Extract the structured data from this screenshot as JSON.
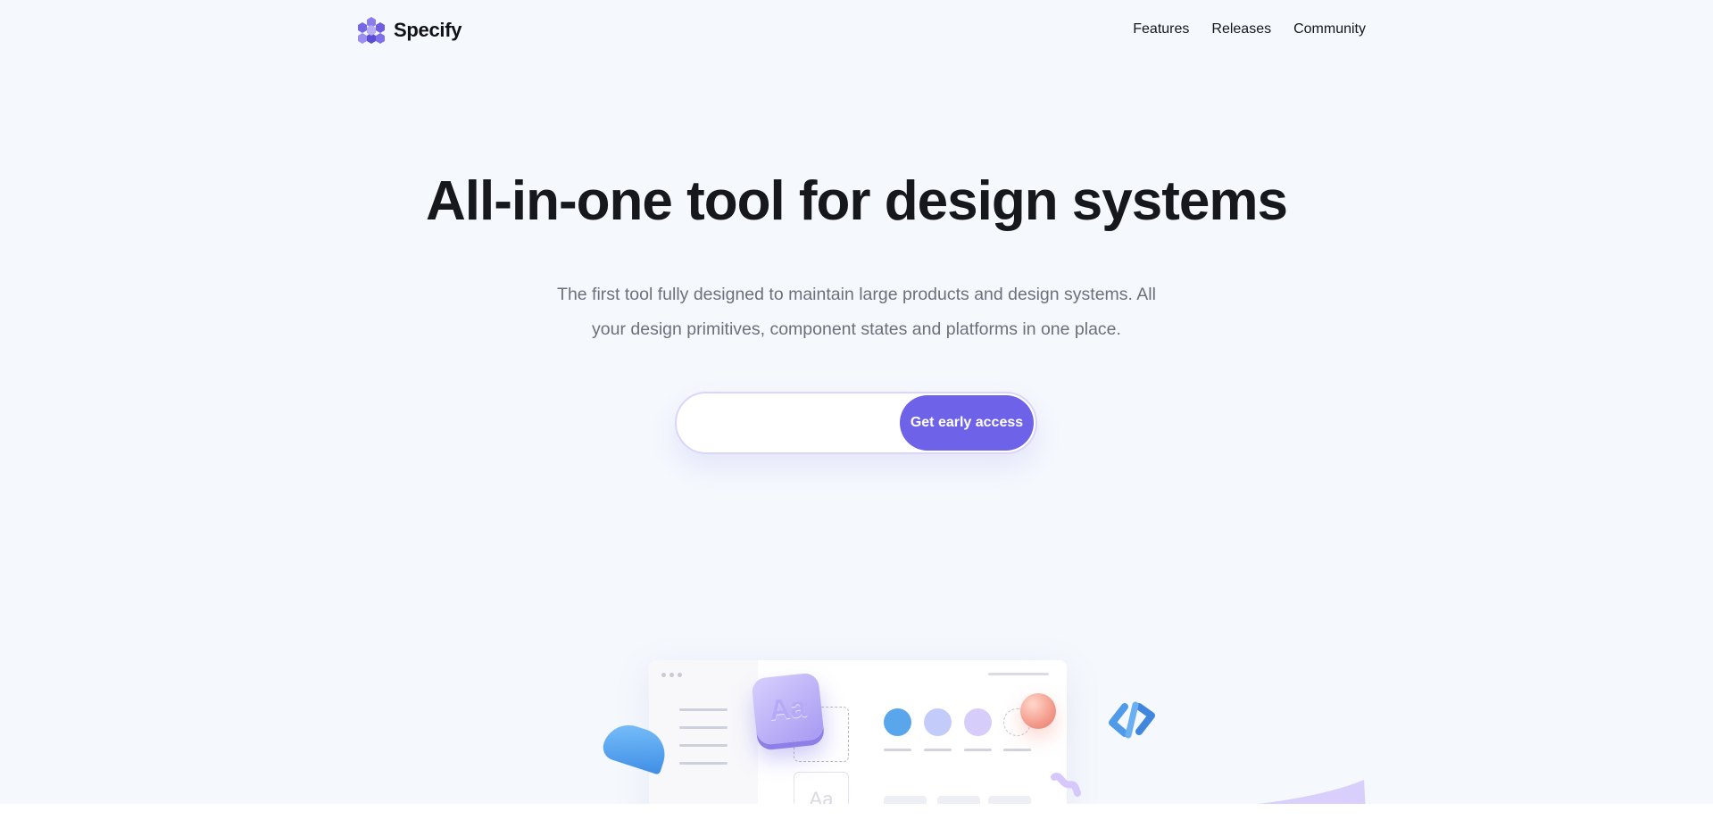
{
  "brand": {
    "name": "Specify",
    "logo_icon": "hexagon-cube-logo-icon",
    "accent_color": "#6e62e8"
  },
  "nav": {
    "items": [
      "Features",
      "Releases",
      "Community"
    ]
  },
  "hero": {
    "headline": "All-in-one tool for design systems",
    "subtitle": "The first tool fully designed to maintain large products and design systems. All your design primitives, component states and platforms in one place."
  },
  "signup": {
    "email_value": "",
    "email_placeholder": "",
    "cta_label": "Get early access"
  },
  "illustration": {
    "typography_tile_text": "Aa",
    "typography_ghost_text": "Aa",
    "swatch_colors": [
      "#5aa6ec",
      "#c3cbfb",
      "#d7cdfb"
    ],
    "icons": [
      "blue-blob-shape-icon",
      "code-brackets-icon",
      "sphere-shape-icon",
      "squiggle-shape-icon"
    ]
  }
}
